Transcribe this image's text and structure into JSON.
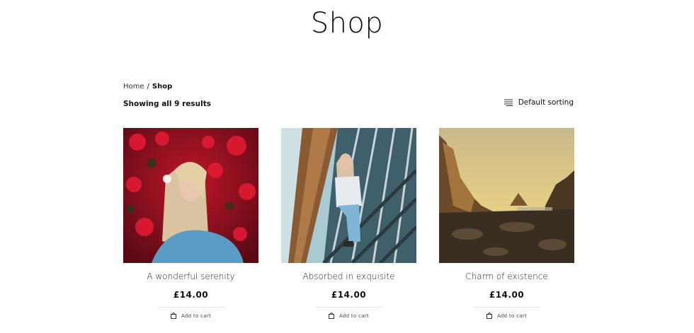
{
  "page": {
    "title": "Shop"
  },
  "breadcrumb": {
    "home": "Home",
    "separator": "/",
    "current": "Shop"
  },
  "results": {
    "text": "Showing all 9 results"
  },
  "sorting": {
    "label": "Default sorting",
    "icon": "sort-lines-icon"
  },
  "products": [
    {
      "title": "A wonderful serenity",
      "price": "£14.00",
      "add_to_cart": "Add to cart",
      "image": "woman-red-flowers"
    },
    {
      "title": "Absorbed in exquisite",
      "price": "£14.00",
      "add_to_cart": "Add to cart",
      "image": "woman-sitting-building"
    },
    {
      "title": "Charm of existence",
      "price": "£14.00",
      "add_to_cart": "Add to cart",
      "image": "rocky-coast-sunset"
    }
  ],
  "colors": {
    "text": "#111111",
    "divider": "#e6e6e6",
    "background": "#ffffff"
  }
}
